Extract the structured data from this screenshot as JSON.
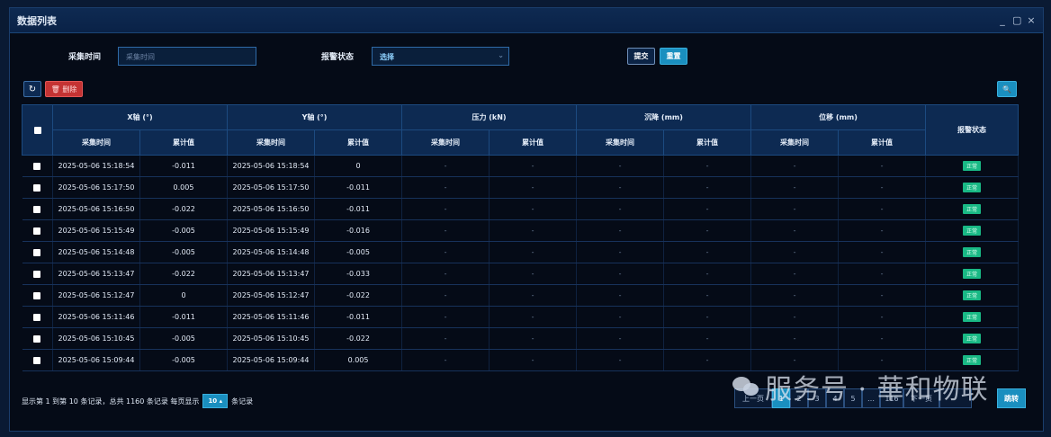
{
  "window": {
    "title": "数据列表",
    "controls": [
      "_",
      "▢",
      "×"
    ]
  },
  "filter": {
    "time_label": "采集时间",
    "time_placeholder": "采集时间",
    "alarm_label": "报警状态",
    "alarm_value": "选择",
    "submit_label": "提交",
    "reset_label": "重置"
  },
  "toolbar": {
    "refresh_icon": "↻",
    "delete_label": "🗑 删除",
    "search_icon": "🔍"
  },
  "table": {
    "groups": [
      "X轴 (°)",
      "Y轴 (°)",
      "压力 (kN)",
      "沉降 (mm)",
      "位移 (mm)"
    ],
    "sub_time": "采集时间",
    "sub_value": "累计值",
    "status_header": "报警状态",
    "rows": [
      {
        "x_time": "2025-05-06 15:18:54",
        "x_val": "-0.011",
        "y_time": "2025-05-06 15:18:54",
        "y_val": "0",
        "status": "正常"
      },
      {
        "x_time": "2025-05-06 15:17:50",
        "x_val": "0.005",
        "y_time": "2025-05-06 15:17:50",
        "y_val": "-0.011",
        "status": "正常"
      },
      {
        "x_time": "2025-05-06 15:16:50",
        "x_val": "-0.022",
        "y_time": "2025-05-06 15:16:50",
        "y_val": "-0.011",
        "status": "正常"
      },
      {
        "x_time": "2025-05-06 15:15:49",
        "x_val": "-0.005",
        "y_time": "2025-05-06 15:15:49",
        "y_val": "-0.016",
        "status": "正常"
      },
      {
        "x_time": "2025-05-06 15:14:48",
        "x_val": "-0.005",
        "y_time": "2025-05-06 15:14:48",
        "y_val": "-0.005",
        "status": "正常"
      },
      {
        "x_time": "2025-05-06 15:13:47",
        "x_val": "-0.022",
        "y_time": "2025-05-06 15:13:47",
        "y_val": "-0.033",
        "status": "正常"
      },
      {
        "x_time": "2025-05-06 15:12:47",
        "x_val": "0",
        "y_time": "2025-05-06 15:12:47",
        "y_val": "-0.022",
        "status": "正常"
      },
      {
        "x_time": "2025-05-06 15:11:46",
        "x_val": "-0.011",
        "y_time": "2025-05-06 15:11:46",
        "y_val": "-0.011",
        "status": "正常"
      },
      {
        "x_time": "2025-05-06 15:10:45",
        "x_val": "-0.005",
        "y_time": "2025-05-06 15:10:45",
        "y_val": "-0.022",
        "status": "正常"
      },
      {
        "x_time": "2025-05-06 15:09:44",
        "x_val": "-0.005",
        "y_time": "2025-05-06 15:09:44",
        "y_val": "0.005",
        "status": "正常"
      }
    ],
    "empty": "-"
  },
  "footer": {
    "summary": "显示第 1 到第 10 条记录，总共 1160 条记录 每页显示",
    "page_size": "10 ▴",
    "suffix": "条记录"
  },
  "pager": {
    "pages": [
      "上一页",
      "1",
      "2",
      "3",
      "4",
      "5",
      "…",
      "116",
      "下一页",
      ""
    ],
    "go_label": "跳转"
  },
  "watermark": "服务号 · 華和物联"
}
